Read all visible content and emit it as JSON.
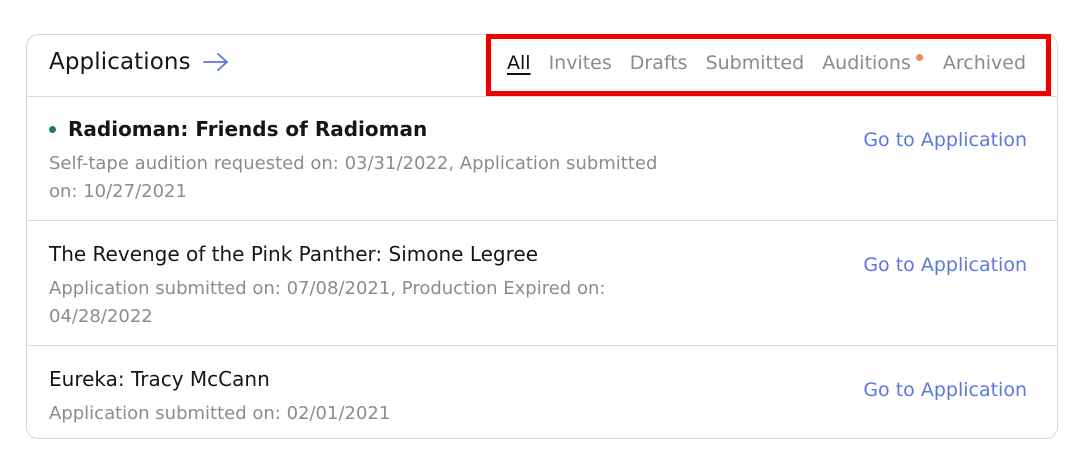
{
  "header": {
    "title": "Applications",
    "arrow_icon": "arrow-right-icon"
  },
  "tabs": [
    {
      "label": "All",
      "active": true
    },
    {
      "label": "Invites"
    },
    {
      "label": "Drafts"
    },
    {
      "label": "Submitted"
    },
    {
      "label": "Auditions",
      "notification_dot": true
    },
    {
      "label": "Archived"
    }
  ],
  "applications": [
    {
      "title": "Radioman: Friends of Radioman",
      "unread": true,
      "subtitle": "Self-tape audition requested on: 03/31/2022, Application submitted on: 10/27/2021",
      "link": "Go to Application"
    },
    {
      "title": "The Revenge of the Pink Panther: Simone Legree",
      "subtitle": "Application submitted on: 07/08/2021, Production Expired on: 04/28/2022",
      "link": "Go to Application"
    },
    {
      "title": "Eureka: Tracy McCann",
      "subtitle": "Application submitted on: 02/01/2021",
      "link": "Go to Application"
    }
  ],
  "colors": {
    "accent": "#5b78e0",
    "highlight_border": "#ee0000",
    "notification_dot": "#f2875d",
    "unread_dot": "#1f7a67"
  }
}
